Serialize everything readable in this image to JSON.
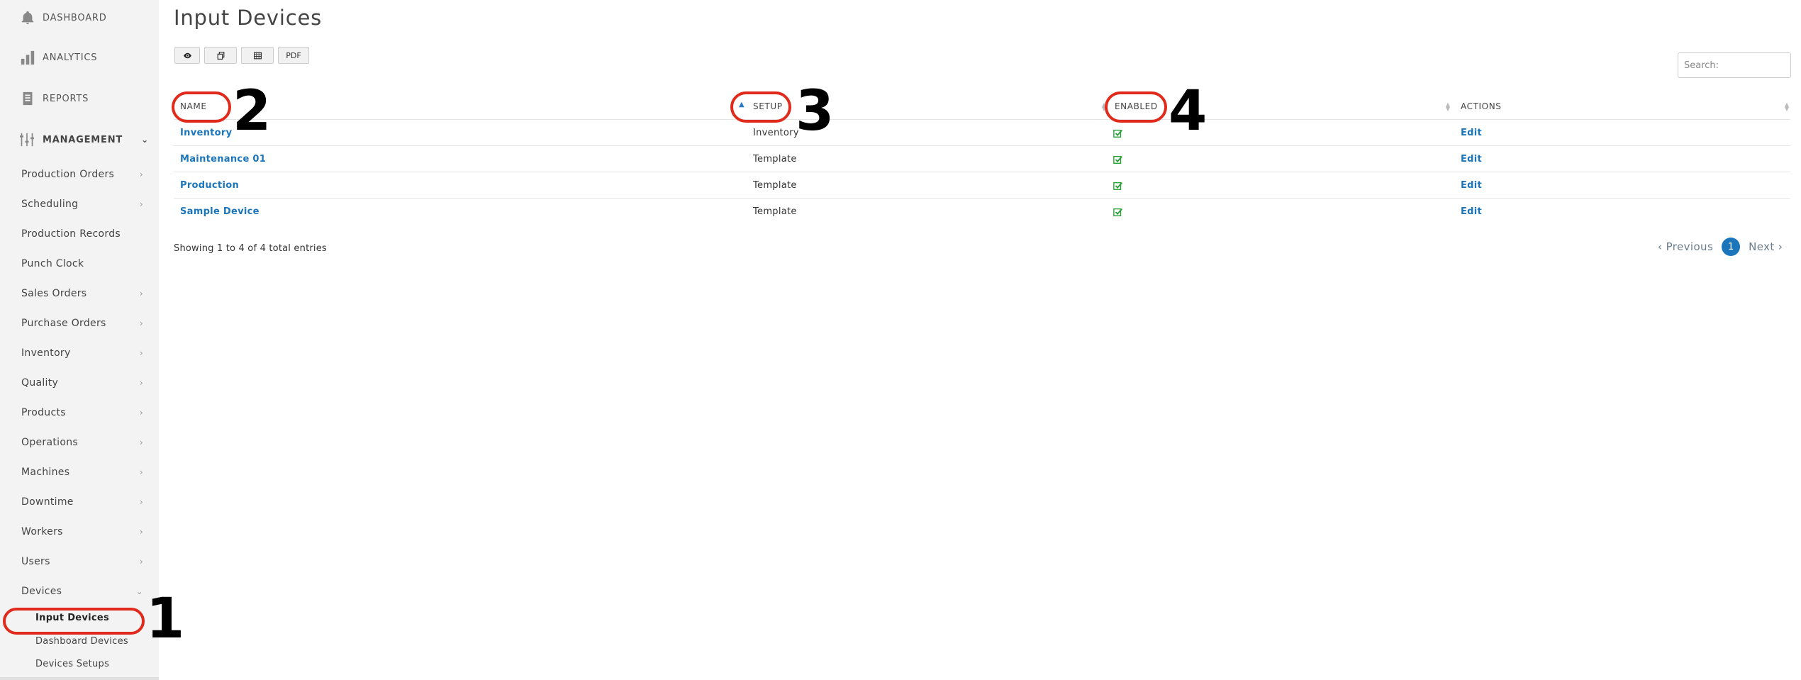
{
  "sidebar": {
    "top": [
      {
        "label": "DASHBOARD",
        "icon": "bell-icon"
      },
      {
        "label": "ANALYTICS",
        "icon": "bar-chart-icon"
      },
      {
        "label": "REPORTS",
        "icon": "report-icon"
      }
    ],
    "management": {
      "label": "MANAGEMENT",
      "icon": "management-icon",
      "chevron": "chevron-down-icon"
    },
    "items": [
      {
        "label": "Production Orders",
        "has_arrow": true
      },
      {
        "label": "Scheduling",
        "has_arrow": true
      },
      {
        "label": "Production Records",
        "has_arrow": false
      },
      {
        "label": "Punch Clock",
        "has_arrow": false
      },
      {
        "label": "Sales Orders",
        "has_arrow": true
      },
      {
        "label": "Purchase Orders",
        "has_arrow": true
      },
      {
        "label": "Inventory",
        "has_arrow": true
      },
      {
        "label": "Quality",
        "has_arrow": true
      },
      {
        "label": "Products",
        "has_arrow": true
      },
      {
        "label": "Operations",
        "has_arrow": true
      },
      {
        "label": "Machines",
        "has_arrow": true
      },
      {
        "label": "Downtime",
        "has_arrow": true
      },
      {
        "label": "Workers",
        "has_arrow": true
      },
      {
        "label": "Users",
        "has_arrow": true
      },
      {
        "label": "Devices",
        "has_arrow": true,
        "expanded": true
      }
    ],
    "sub_items": [
      {
        "label": "Input Devices",
        "active": true
      },
      {
        "label": "Dashboard Devices",
        "active": false
      },
      {
        "label": "Devices Setups",
        "active": false
      }
    ],
    "arrow_glyph": "›",
    "expanded_glyph": "⌄"
  },
  "page": {
    "title": "Input Devices"
  },
  "toolbar": {
    "buttons": [
      {
        "name": "view-button",
        "icon": "eye-icon"
      },
      {
        "name": "copy-button",
        "icon": "copy-icon"
      },
      {
        "name": "csv-button",
        "icon": "table-icon"
      },
      {
        "name": "pdf-button",
        "label": "PDF"
      }
    ]
  },
  "search": {
    "placeholder": "Search:"
  },
  "table": {
    "columns": [
      "NAME",
      "SETUP",
      "ENABLED",
      "ACTIONS"
    ],
    "sorted_column": "SETUP",
    "rows": [
      {
        "name": "Inventory",
        "setup": "Inventory",
        "enabled": true,
        "action": "Edit"
      },
      {
        "name": "Maintenance 01",
        "setup": "Template",
        "enabled": true,
        "action": "Edit"
      },
      {
        "name": "Production",
        "setup": "Template",
        "enabled": true,
        "action": "Edit"
      },
      {
        "name": "Sample Device",
        "setup": "Template",
        "enabled": true,
        "action": "Edit"
      }
    ]
  },
  "footer": {
    "entries_info": "Showing 1 to 4 of 4 total entries",
    "previous": "‹ Previous",
    "current_page": "1",
    "next": "Next ›"
  },
  "annotations": [
    "1",
    "2",
    "3",
    "4"
  ],
  "colors": {
    "accent": "#1b75bb",
    "annotation": "#e02a1b",
    "check": "#2e9e3a",
    "sidebar_bg": "#f3f3f3"
  }
}
